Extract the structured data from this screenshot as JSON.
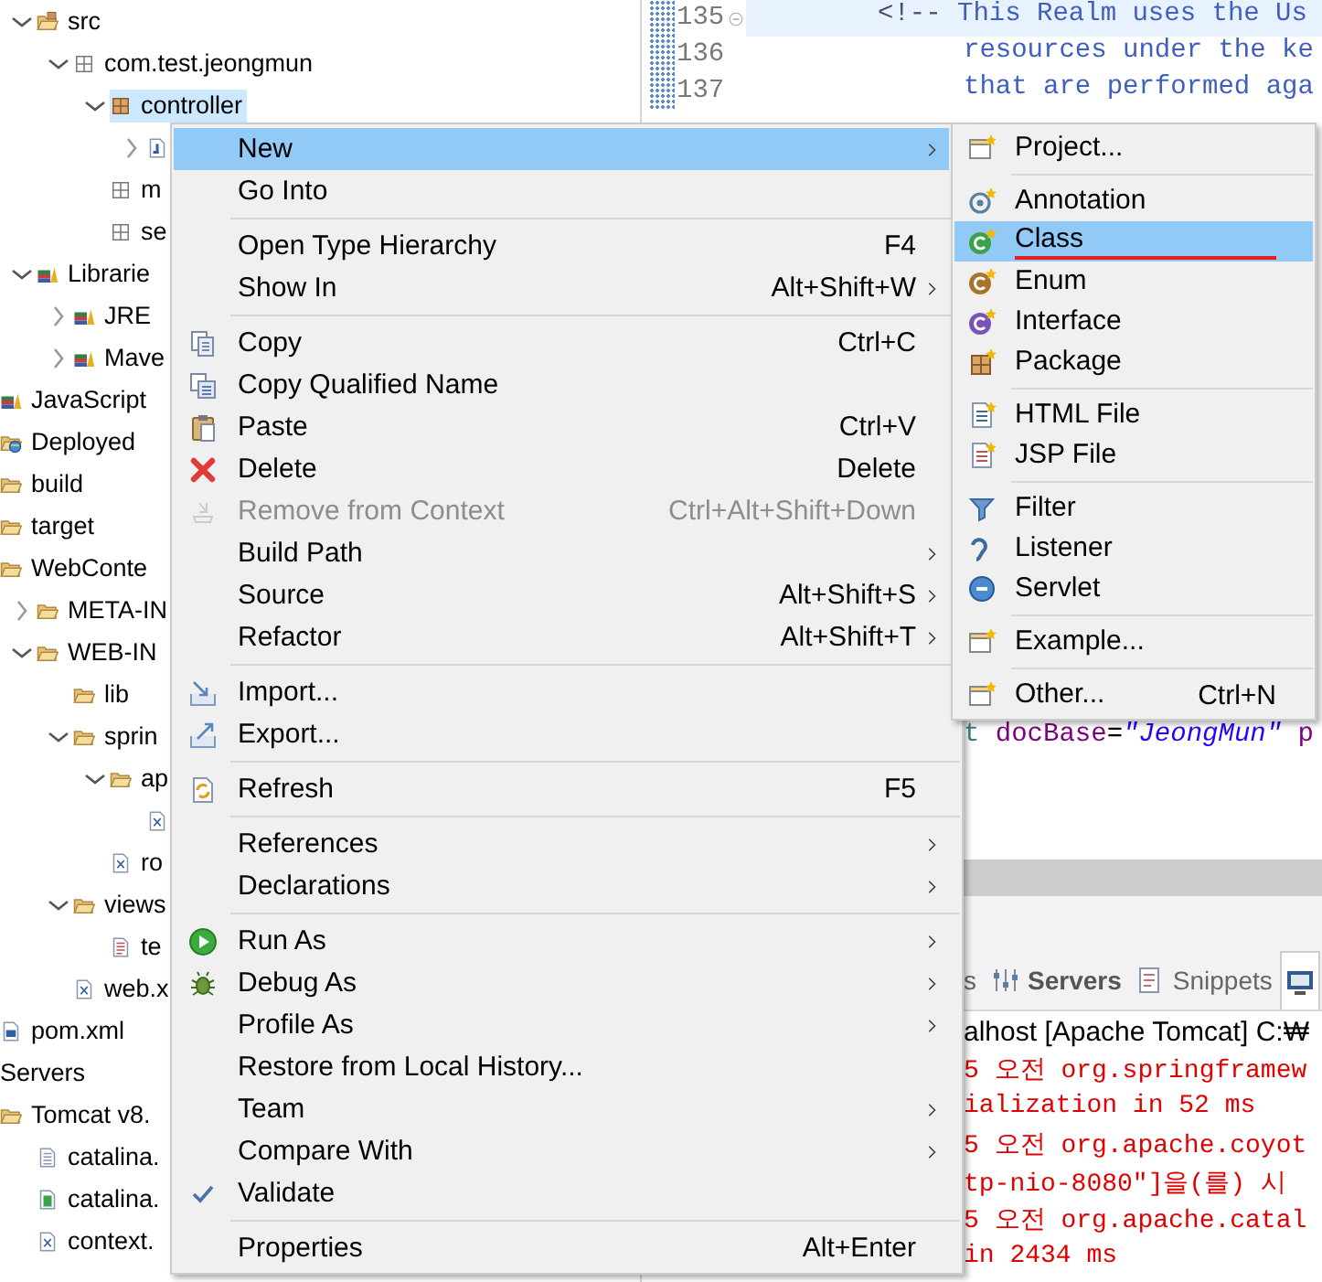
{
  "tree": {
    "items": [
      {
        "children": [
          {
            "children": [
              {
                "label": "src",
                "kind": "srcfolder",
                "expanded": true,
                "selected": false,
                "children": [
                  {
                    "label": "com.test.jeongmun",
                    "kind": "emptypackage",
                    "expanded": true,
                    "selected": false,
                    "children": [
                      {
                        "label": "controller",
                        "kind": "package",
                        "expanded": true,
                        "selected": true,
                        "children": [
                          {
                            "kind": "java",
                            "expanded": false,
                            "selected": false
                          }
                        ]
                      },
                      {
                        "label": "m",
                        "kind": "emptypackage",
                        "selected": false
                      },
                      {
                        "label": "se",
                        "kind": "emptypackage",
                        "selected": false
                      }
                    ]
                  }
                ]
              },
              {
                "label": "Librarie",
                "kind": "library",
                "expanded": true,
                "selected": false,
                "children": [
                  {
                    "label": "JRE",
                    "kind": "library",
                    "expanded": false,
                    "selected": false
                  },
                  {
                    "label": "Mave",
                    "kind": "library",
                    "expanded": false,
                    "selected": false
                  }
                ]
              }
            ]
          },
          {
            "label": "JavaScript",
            "kind": "library",
            "selected": false
          },
          {
            "label": "Deployed",
            "kind": "deploy",
            "selected": false
          },
          {
            "label": "build",
            "kind": "folder",
            "selected": false
          },
          {
            "label": "target",
            "kind": "folder",
            "selected": false
          },
          {
            "label": "WebConte",
            "kind": "folder",
            "selected": false,
            "children": [
              {
                "label": "META-IN",
                "kind": "folder",
                "expanded": false,
                "selected": false
              },
              {
                "label": "WEB-IN",
                "kind": "folder",
                "expanded": true,
                "selected": false,
                "children": [
                  {
                    "label": "lib",
                    "kind": "folder",
                    "selected": false
                  },
                  {
                    "label": "sprin",
                    "kind": "folder",
                    "expanded": true,
                    "selected": false,
                    "children": [
                      {
                        "label": "ap",
                        "kind": "folder",
                        "expanded": true,
                        "selected": false,
                        "children": [
                          {
                            "kind": "xml",
                            "selected": false
                          }
                        ]
                      },
                      {
                        "label": "ro",
                        "kind": "xml",
                        "selected": false
                      }
                    ]
                  },
                  {
                    "label": "views",
                    "kind": "folder",
                    "expanded": true,
                    "selected": false,
                    "children": [
                      {
                        "label": "te",
                        "kind": "page",
                        "selected": false
                      }
                    ]
                  },
                  {
                    "label": "web.x",
                    "kind": "xml",
                    "selected": false
                  }
                ]
              }
            ]
          },
          {
            "label": "pom.xml",
            "kind": "maven",
            "selected": false
          }
        ]
      },
      {
        "label": "Servers",
        "selected": false,
        "children": [
          {
            "label": "Tomcat v8.",
            "kind": "folder",
            "selected": false,
            "children": [
              {
                "label": "catalina.",
                "kind": "text",
                "selected": false
              },
              {
                "label": "catalina.",
                "kind": "props",
                "selected": false
              },
              {
                "label": "context.",
                "kind": "xml",
                "selected": false
              }
            ]
          }
        ]
      }
    ]
  },
  "editor": {
    "lines": [
      {
        "number": "135",
        "current": true,
        "foldable": true,
        "tokens": [
          {
            "text": "<!--",
            "kind": "markup"
          },
          {
            "text": " This Realm uses the Us",
            "kind": "comment"
          }
        ]
      },
      {
        "number": "136",
        "current": false,
        "foldable": false,
        "tokens": [
          {
            "text": "resources under the ke",
            "kind": "comment"
          }
        ]
      },
      {
        "number": "137",
        "current": false,
        "foldable": false,
        "tokens": [
          {
            "text": "that are performed aga",
            "kind": "comment"
          }
        ]
      }
    ],
    "lower_fragment": {
      "tokens": [
        {
          "text": "t ",
          "kind": "tag"
        },
        {
          "text": "docBase",
          "kind": "attribute"
        },
        {
          "text": "=",
          "kind": "plain"
        },
        {
          "text": "\"JeongMun\"",
          "kind": "string"
        },
        {
          "text": " p",
          "kind": "attribute"
        }
      ]
    }
  },
  "console": {
    "tabs": [
      {
        "label": "s",
        "selected": false,
        "bold": false
      },
      {
        "label": "Servers",
        "selected": false,
        "bold": true
      },
      {
        "label": "Snippets",
        "selected": false,
        "bold": false
      },
      {
        "selected": true,
        "bold": false
      }
    ],
    "title": "alhost [Apache Tomcat] C:₩",
    "lines": [
      {
        "text": "5 오전 org.springframew",
        "kind": "error"
      },
      {
        "text": "ialization in 52 ms",
        "kind": "error"
      },
      {
        "text": "5 오전 org.apache.coyot",
        "kind": "error"
      },
      {
        "text": "tp-nio-8080\"]을(를) 시",
        "kind": "error"
      },
      {
        "text": "5 오전 org.apache.catal",
        "kind": "error"
      },
      {
        "text": "in 2434 ms",
        "kind": "error"
      }
    ]
  },
  "context_menu": {
    "groups": [
      [
        {
          "label": "New",
          "submenu": true,
          "selected": true,
          "disabled": false
        },
        {
          "label": "Go Into",
          "submenu": false,
          "selected": false,
          "disabled": false
        }
      ],
      [
        {
          "label": "Open Type Hierarchy",
          "shortcut": "F4",
          "submenu": false,
          "selected": false,
          "disabled": false
        },
        {
          "label": "Show In",
          "shortcut": "Alt+Shift+W",
          "submenu": true,
          "selected": false,
          "disabled": false
        }
      ],
      [
        {
          "label": "Copy",
          "shortcut": "Ctrl+C",
          "submenu": false,
          "selected": false,
          "disabled": false
        },
        {
          "label": "Copy Qualified Name",
          "submenu": false,
          "selected": false,
          "disabled": false
        },
        {
          "label": "Paste",
          "shortcut": "Ctrl+V",
          "submenu": false,
          "selected": false,
          "disabled": false
        },
        {
          "label": "Delete",
          "shortcut": "Delete",
          "submenu": false,
          "selected": false,
          "disabled": false
        },
        {
          "label": "Remove from Context",
          "shortcut": "Ctrl+Alt+Shift+Down",
          "submenu": false,
          "selected": false,
          "disabled": true
        },
        {
          "label": "Build Path",
          "submenu": true,
          "selected": false,
          "disabled": false
        },
        {
          "label": "Source",
          "shortcut": "Alt+Shift+S",
          "submenu": true,
          "selected": false,
          "disabled": false
        },
        {
          "label": "Refactor",
          "shortcut": "Alt+Shift+T",
          "submenu": true,
          "selected": false,
          "disabled": false
        }
      ],
      [
        {
          "label": "Import...",
          "submenu": false,
          "selected": false,
          "disabled": false
        },
        {
          "label": "Export...",
          "submenu": false,
          "selected": false,
          "disabled": false
        }
      ],
      [
        {
          "label": "Refresh",
          "shortcut": "F5",
          "submenu": false,
          "selected": false,
          "disabled": false
        }
      ],
      [
        {
          "label": "References",
          "submenu": true,
          "selected": false,
          "disabled": false
        },
        {
          "label": "Declarations",
          "submenu": true,
          "selected": false,
          "disabled": false
        }
      ],
      [
        {
          "label": "Run As",
          "submenu": true,
          "selected": false,
          "disabled": false
        },
        {
          "label": "Debug As",
          "submenu": true,
          "selected": false,
          "disabled": false
        },
        {
          "label": "Profile As",
          "submenu": true,
          "selected": false,
          "disabled": false
        },
        {
          "label": "Restore from Local History...",
          "submenu": false,
          "selected": false,
          "disabled": false
        },
        {
          "label": "Team",
          "submenu": true,
          "selected": false,
          "disabled": false
        },
        {
          "label": "Compare With",
          "submenu": true,
          "selected": false,
          "disabled": false
        },
        {
          "label": "Validate",
          "submenu": false,
          "selected": false,
          "disabled": false
        }
      ],
      [
        {
          "label": "Properties",
          "shortcut": "Alt+Enter",
          "submenu": false,
          "selected": false,
          "disabled": false
        }
      ]
    ]
  },
  "new_submenu": {
    "groups": [
      [
        {
          "label": "Project...",
          "selected": false,
          "underlined": false
        }
      ],
      [
        {
          "label": "Annotation",
          "selected": false,
          "underlined": false
        },
        {
          "label": "Class",
          "selected": true,
          "underlined": true
        },
        {
          "label": "Enum",
          "selected": false,
          "underlined": false
        },
        {
          "label": "Interface",
          "selected": false,
          "underlined": false
        },
        {
          "label": "Package",
          "selected": false,
          "underlined": false
        }
      ],
      [
        {
          "label": "HTML File",
          "selected": false,
          "underlined": false
        },
        {
          "label": "JSP File",
          "selected": false,
          "underlined": false
        }
      ],
      [
        {
          "label": "Filter",
          "selected": false,
          "underlined": false
        },
        {
          "label": "Listener",
          "selected": false,
          "underlined": false
        },
        {
          "label": "Servlet",
          "selected": false,
          "underlined": false
        }
      ],
      [
        {
          "label": "Example...",
          "selected": false,
          "underlined": false
        }
      ],
      [
        {
          "label": "Other...",
          "shortcut": "Ctrl+N",
          "selected": false,
          "underlined": false
        }
      ]
    ]
  }
}
